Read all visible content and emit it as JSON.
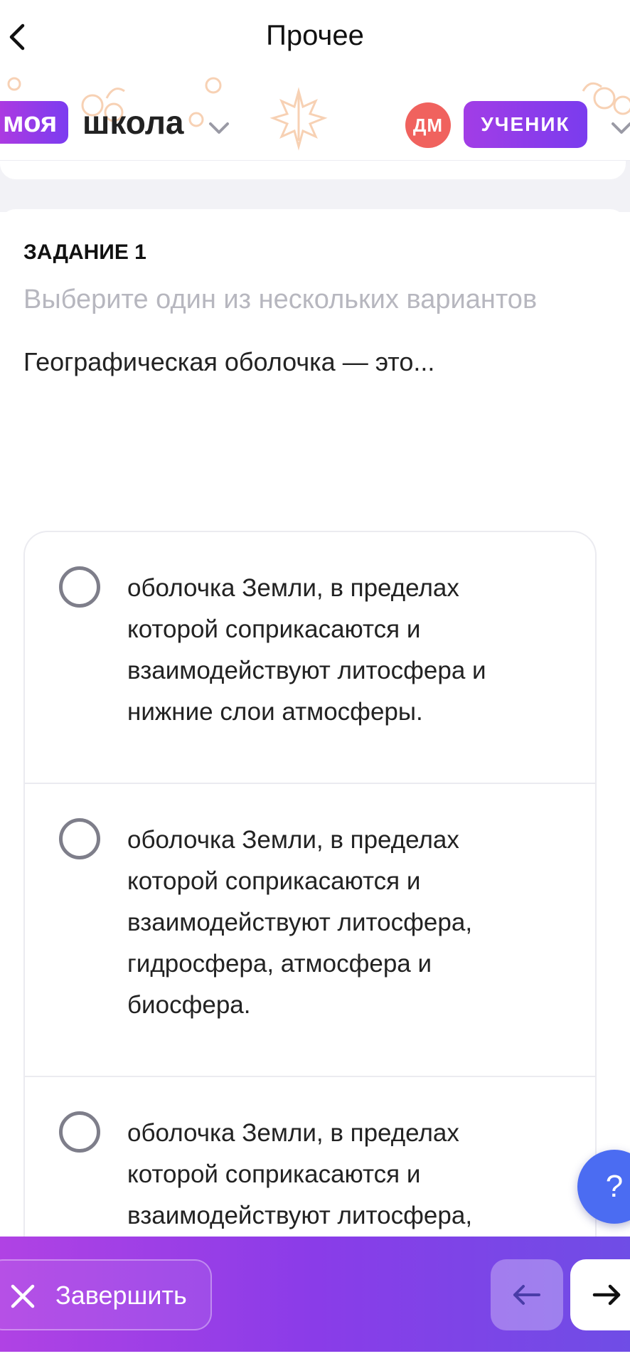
{
  "nav": {
    "title": "Прочее",
    "back_icon": "chevron-left-icon"
  },
  "brand": {
    "logo_part1": "моя",
    "logo_part2": "школа",
    "avatar_initials": "ДМ",
    "role_label": "УЧЕНИК"
  },
  "task": {
    "label": "ЗАДАНИЕ 1",
    "hint": "Выберите один из нескольких вариантов",
    "question": "Географическая оболочка — это..."
  },
  "options": [
    {
      "lines": [
        "оболочка Земли, в пределах",
        "которой соприкасаются и",
        "взаимодействуют литосфера и",
        "нижние слои атмосферы."
      ],
      "selected": false
    },
    {
      "lines": [
        "оболочка Земли, в пределах",
        "которой соприкасаются и",
        "взаимодействуют литосфера,",
        "гидросфера, атмосфера и",
        "биосфера."
      ],
      "selected": false
    },
    {
      "lines": [
        "оболочка Земли, в пределах",
        "которой соприкасаются и",
        "взаимодействуют литосфера,"
      ],
      "selected": false
    }
  ],
  "help": {
    "label": "?"
  },
  "bottom": {
    "finish_label": "Завершить",
    "prev_icon": "arrow-left-icon",
    "next_icon": "arrow-right-icon"
  },
  "colors": {
    "accent_purple": "#7b3cf0",
    "avatar_red": "#f0625e",
    "help_blue": "#4b6cf2",
    "hint_gray": "#b7b7bf"
  }
}
